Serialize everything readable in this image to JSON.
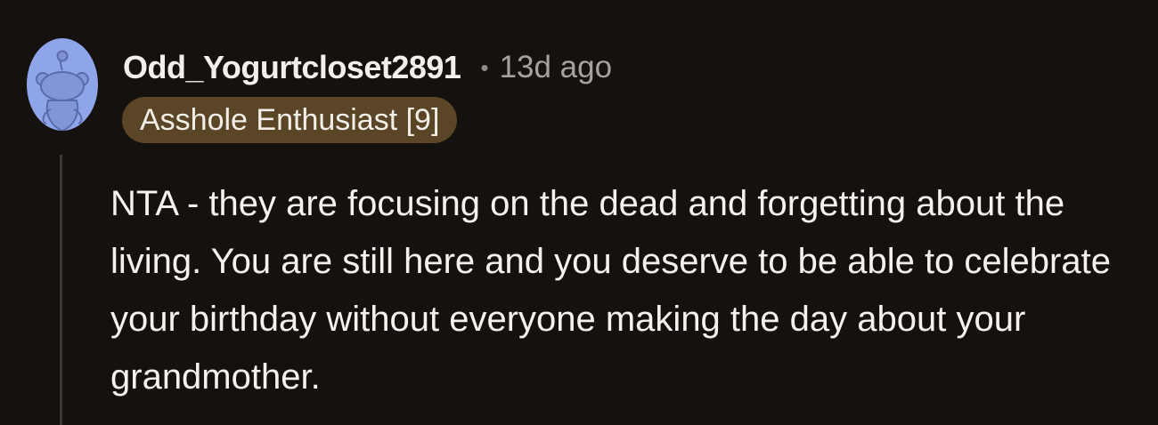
{
  "comment": {
    "username": "Odd_Yogurtcloset2891",
    "separator": "•",
    "timestamp": "13d ago",
    "flair": "Asshole Enthusiast [9]",
    "body": "NTA - they are focusing on the dead and forgetting about the living. You are still here and you deserve to be able to celebrate your birthday without everyone making the day about your grandmother."
  },
  "avatar": {
    "icon": "reddit-snoo-avatar-icon",
    "background_color": "#8fa5ea",
    "figure_color": "#8196d9",
    "outline_color": "#5b6ba9"
  },
  "colors": {
    "page_background": "#15110f",
    "flair_background": "#5a4626",
    "thread_line": "#3c3835"
  }
}
